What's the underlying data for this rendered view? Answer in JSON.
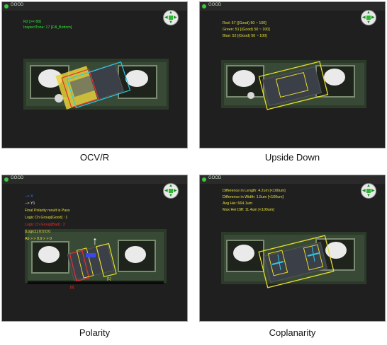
{
  "panels": [
    {
      "status": "GOOD",
      "caption": "OCV/R",
      "overlay": [
        "R2 [>= 80]",
        "InspectTone: 17 [Fill_Bottom]"
      ]
    },
    {
      "status": "GOOD",
      "caption": "Upside Down",
      "overlay": [
        "Red:  57 [(Good) 50 ~ 100]",
        "Green:  51 [(Good) 50 ~ 100]",
        "Blue:  52 [(Good) 50 ~ 100]"
      ]
    },
    {
      "status": "GOOD",
      "caption": "Polarity",
      "overlay": [
        "--> X",
        "--> Y1",
        "Final Polarity result is Pass",
        "Logic Ch Group[Good] : 1",
        "Logic Ch Group[Bad] : 2",
        "[Logic1] 0:0:0:0",
        "Ab > > 0.9 > > 0"
      ]
    },
    {
      "status": "GOOD",
      "caption": "Coplanarity",
      "overlay": [
        "Difference in Length:     4.2um [<100um]",
        "Difference in Width:      1.5um [<100um]",
        "Avg Hei: 664.1um",
        "Max Hei Diff:   11.4um [<100um]"
      ]
    }
  ],
  "colors": {
    "panel_bg": "#1f1f1f",
    "board": "#2f3a2c",
    "pad": "#e8e8e8",
    "overlay_green": "#34e534",
    "overlay_yellow": "#e6e13a",
    "box_yellow": "#e8dc2c",
    "box_cyan": "#2fc8e8",
    "box_red": "#e83030",
    "status_green": "#3ec83e"
  },
  "icons": [
    "navigation-pad-icon",
    "status-dot-icon",
    "up-arrow-icon"
  ]
}
